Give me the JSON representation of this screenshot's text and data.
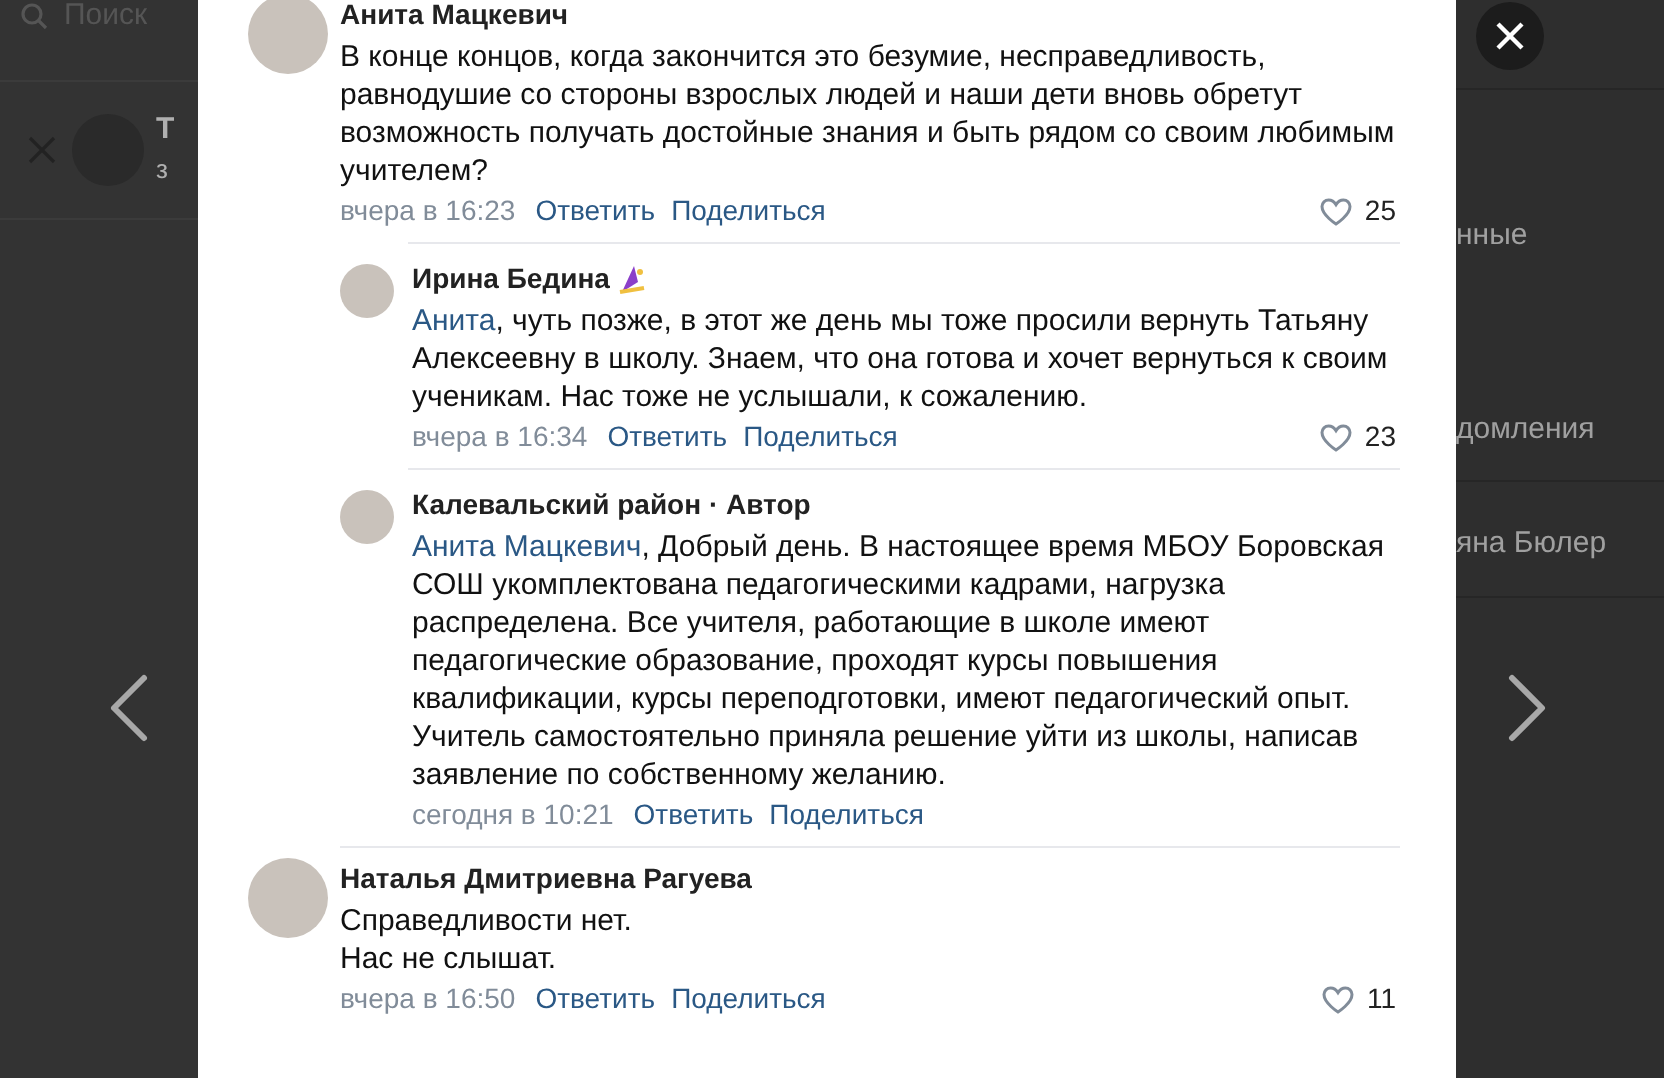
{
  "background": {
    "search_placeholder": "Поиск",
    "left_item_initial": "Т",
    "left_item_subtitle": "з",
    "right_items": [
      "нные",
      "домления",
      "яна Бюлер"
    ]
  },
  "comments": [
    {
      "author": "Анита Мацкевич",
      "badge": false,
      "text": "В конце концов, когда закончится это безумие, несправедливость, равнодушие со стороны взрослых людей и наши дети вновь обретут возможность получать достойные знания и быть рядом со своим любимым учителем?",
      "time": "вчера в 16:23",
      "actions": [
        "Ответить",
        "Поделиться"
      ],
      "likes": "25",
      "replies": [
        {
          "author": "Ирина Бедина",
          "badge": true,
          "mention": "Анита",
          "text": ", чуть позже, в этот же день мы тоже просили вернуть Татьяну Алексеевну в школу. Знаем, что она готова и хочет вернуться к своим ученикам. Нас тоже не услышали, к сожалению.",
          "time": "вчера в 16:34",
          "actions": [
            "Ответить",
            "Поделиться"
          ],
          "likes": "23"
        },
        {
          "author": "Калевальский район · Автор",
          "badge": false,
          "mention": "Анита Мацкевич",
          "text": ", Добрый день. В настоящее время МБОУ Боровская СОШ укомплектована педагогическими кадрами, нагрузка распределена. Все учителя, работающие в школе имеют педагогические образование, проходят курсы повышения квалификации, курсы переподготовки, имеют педагогический опыт. Учитель самостоятельно приняла решение уйти из школы, написав заявление по собственному желанию.",
          "time": "сегодня в 10:21",
          "actions": [
            "Ответить",
            "Поделиться"
          ]
        }
      ]
    },
    {
      "author": "Наталья Дмитриевна Рагуева",
      "badge": false,
      "text": "Справедливости нет.\nНас не слышат.",
      "time": "вчера в 16:50",
      "actions": [
        "Ответить",
        "Поделиться"
      ],
      "likes": "11"
    }
  ]
}
